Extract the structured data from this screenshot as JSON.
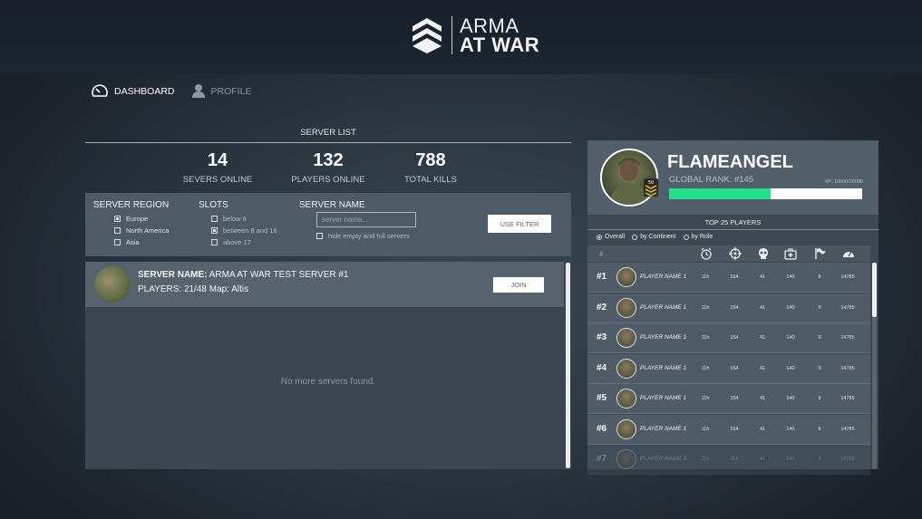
{
  "app": {
    "logo_line1": "ARMA",
    "logo_line2": "AT WAR"
  },
  "nav": {
    "dashboard": "DASHBOARD",
    "profile": "PROFILE"
  },
  "server_list": {
    "title": "SERVER LIST",
    "stats": [
      {
        "value": "14",
        "label": "SEVERS ONLINE"
      },
      {
        "value": "132",
        "label": "PLAYERS ONLINE"
      },
      {
        "value": "788",
        "label": "TOTAL KILLS"
      }
    ],
    "filters": {
      "region_title": "SERVER REGION",
      "regions": [
        {
          "label": "Europe",
          "checked": true
        },
        {
          "label": "North America",
          "checked": false
        },
        {
          "label": "Asia",
          "checked": false
        }
      ],
      "slots_title": "SLOTS",
      "slots": [
        {
          "label": "below 8",
          "checked": false
        },
        {
          "label": "between 8 and 16",
          "checked": true
        },
        {
          "label": "above 17",
          "checked": false
        }
      ],
      "name_title": "SERVER NAME",
      "name_placeholder": "server name...",
      "hide_label": "hide empty and full servers",
      "use_filter": "USE FILTER"
    },
    "servers": [
      {
        "name_label": "SERVER NAME:",
        "name": "ARMA AT WAR TEST SERVER #1",
        "players_line": "PLAYERS: 21/48 Map: Altis",
        "join": "JOIN"
      }
    ],
    "empty_message": "No more servers found."
  },
  "profile": {
    "name": "FLAMEANGEL",
    "rank": "GLOBAL RANK: #145",
    "xp": "XP: 10500/20000",
    "xp_fraction": 0.525,
    "badge_number": "50",
    "xp_color": "#23e08b"
  },
  "leaderboard": {
    "title": "TOP 25 PLAYERS",
    "filters": [
      {
        "label": "Overall",
        "selected": true
      },
      {
        "label": "by Continent",
        "selected": false
      },
      {
        "label": "by Role",
        "selected": false
      }
    ],
    "hash": "#",
    "column_icons": [
      "clock-icon",
      "crosshair-icon",
      "skull-icon",
      "medkit-icon",
      "flag-icon",
      "speedometer-icon"
    ],
    "rows": [
      {
        "rank": "#1",
        "name": "PLAYER NAME 1",
        "time": "11h",
        "c2": "154",
        "c3": "41",
        "c4": "140",
        "c5": "9",
        "c6": "14785"
      },
      {
        "rank": "#2",
        "name": "PLAYER NAME 1",
        "time": "11h",
        "c2": "154",
        "c3": "41",
        "c4": "140",
        "c5": "9",
        "c6": "14785"
      },
      {
        "rank": "#3",
        "name": "PLAYER NAME 1",
        "time": "11h",
        "c2": "154",
        "c3": "41",
        "c4": "140",
        "c5": "9",
        "c6": "14785"
      },
      {
        "rank": "#4",
        "name": "PLAYER NAME 1",
        "time": "11h",
        "c2": "154",
        "c3": "41",
        "c4": "140",
        "c5": "9",
        "c6": "14785"
      },
      {
        "rank": "#5",
        "name": "PLAYER NAME 1",
        "time": "11h",
        "c2": "154",
        "c3": "41",
        "c4": "140",
        "c5": "9",
        "c6": "14785"
      },
      {
        "rank": "#6",
        "name": "PLAYER NAME 1",
        "time": "11h",
        "c2": "154",
        "c3": "41",
        "c4": "140",
        "c5": "9",
        "c6": "14785"
      },
      {
        "rank": "#7",
        "name": "PLAYER NAME 1",
        "time": "11h",
        "c2": "154",
        "c3": "41",
        "c4": "140",
        "c5": "9",
        "c6": "14785"
      }
    ]
  }
}
